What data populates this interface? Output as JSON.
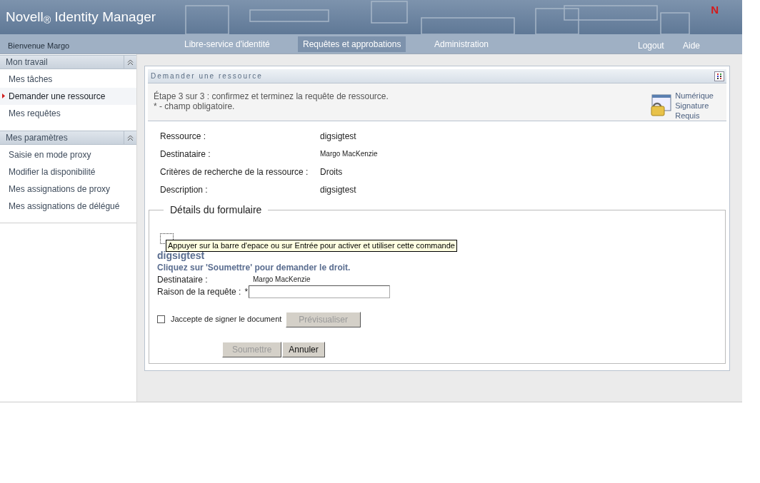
{
  "header": {
    "title": "Novell$_{®}$ Identity Manager",
    "logo": "N"
  },
  "nav": {
    "welcome": "Bienvenue Margo",
    "tabs": [
      {
        "label": "Libre-service d'identité",
        "selected": false
      },
      {
        "label": "Requêtes et approbations",
        "selected": true
      },
      {
        "label": "Administration",
        "selected": false
      }
    ],
    "links": [
      "Logout",
      "Aide"
    ]
  },
  "sidebar": [
    {
      "title": "Mon travail",
      "items": [
        {
          "label": "Mes tâches",
          "selected": false
        },
        {
          "label": "Demander une ressource",
          "selected": true
        },
        {
          "label": "Mes requêtes",
          "selected": false
        }
      ]
    },
    {
      "title": "Mes paramètres",
      "items": [
        {
          "label": "Saisie en mode proxy",
          "selected": false
        },
        {
          "label": "Modifier la disponibilité",
          "selected": false
        },
        {
          "label": "Mes assignations de proxy",
          "selected": false
        },
        {
          "label": "Mes assignations de délégué",
          "selected": false
        }
      ]
    }
  ],
  "panel": {
    "title": "Demander une ressource",
    "step": "Étape 3 sur 3 : confirmez et terminez la requête de ressource.",
    "required_note": "* - champ obligatoire.",
    "signature": [
      "Numérique",
      "Signature",
      "Requis"
    ],
    "details": [
      {
        "label": "Ressource :",
        "value": "digsigtest"
      },
      {
        "label": "Destinataire :",
        "value": "Margo MacKenzie",
        "small": true
      },
      {
        "label": "Critères de recherche de la ressource :",
        "value": "Droits"
      },
      {
        "label": "Description :",
        "value": "digsigtest"
      }
    ],
    "form": {
      "legend": "Détails du formulaire",
      "tooltip": "Appuyer sur la barre d'epace ou sur Entrée pour activer et utiliser cette commande",
      "resource": "digsigtest",
      "instruction": "Cliquez sur 'Soumettre' pour demander le droit.",
      "recipient_label": "Destinataire :",
      "recipient_value": "Margo MacKenzie",
      "reason_label": "Raison de la requête :",
      "required_mark": "*",
      "accept": {
        "label": "Jaccepte de signer le document",
        "checked": false
      },
      "preview_button": {
        "label": "Prévisualiser",
        "disabled": true
      },
      "buttons": [
        {
          "label": "Soumettre",
          "disabled": true
        },
        {
          "label": "Annuler",
          "disabled": false
        }
      ]
    }
  }
}
